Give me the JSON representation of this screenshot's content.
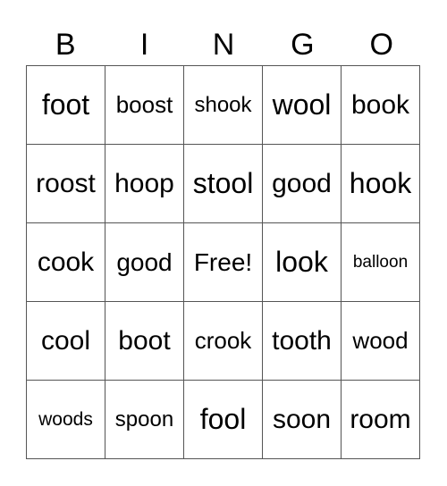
{
  "header": [
    "B",
    "I",
    "N",
    "G",
    "O"
  ],
  "rows": [
    [
      "foot",
      "boost",
      "shook",
      "wool",
      "book"
    ],
    [
      "roost",
      "hoop",
      "stool",
      "good",
      "hook"
    ],
    [
      "cook",
      "good",
      "Free!",
      "look",
      "balloon"
    ],
    [
      "cool",
      "boot",
      "crook",
      "tooth",
      "wood"
    ],
    [
      "woods",
      "spoon",
      "fool",
      "soon",
      "room"
    ]
  ]
}
